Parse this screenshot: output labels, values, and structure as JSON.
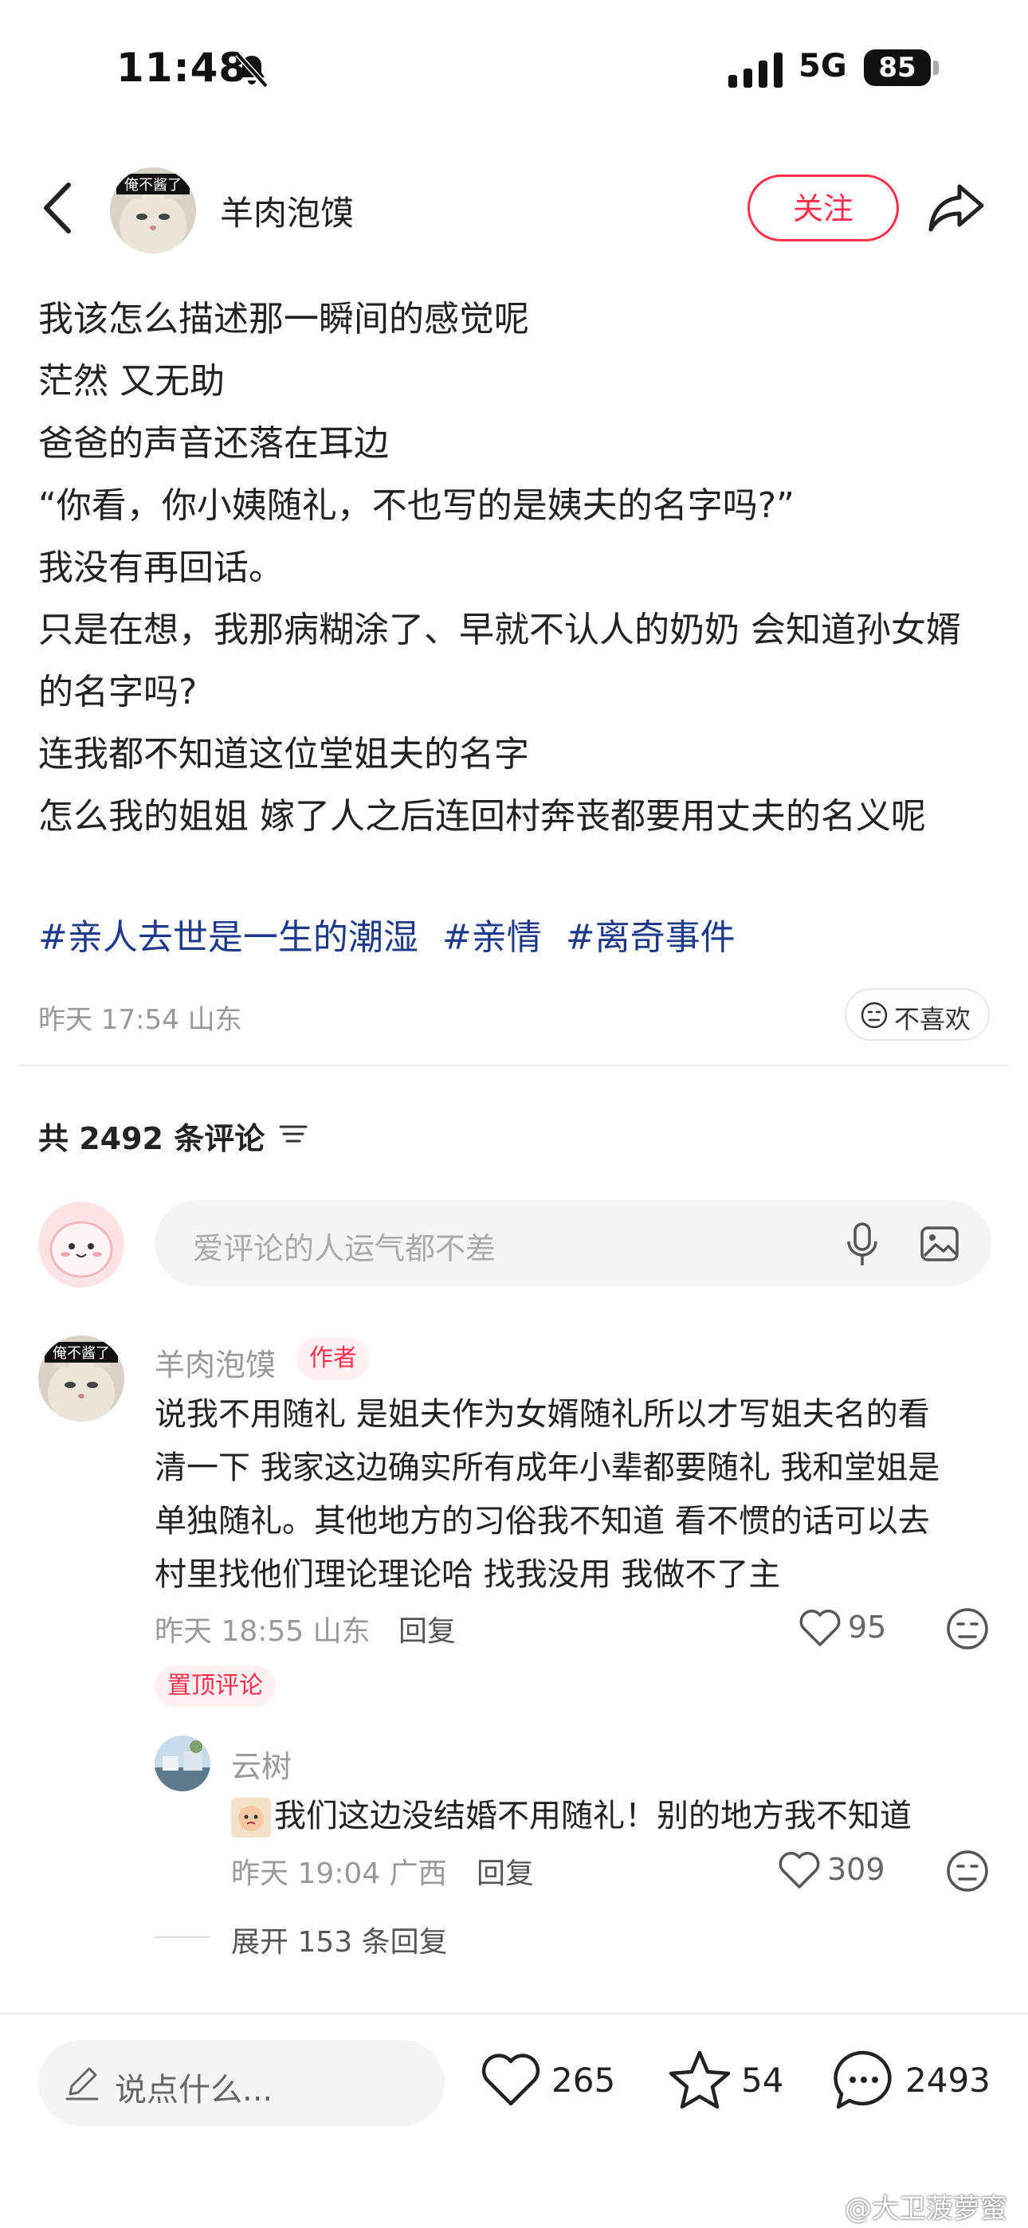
{
  "status_bar": {
    "time": "11:48",
    "network": "5G",
    "battery": "85"
  },
  "header": {
    "author": "羊肉泡馍",
    "avatar_text": "俺不酱了",
    "follow_label": "关注"
  },
  "post": {
    "lines": [
      "我该怎么描述那一瞬间的感觉呢",
      "茫然 又无助",
      "爸爸的声音还落在耳边",
      "“你看，你小姨随礼，不也写的是姨夫的名字吗?”",
      "我没有再回话。",
      "只是在想，我那病糊涂了、早就不认人的奶奶 会知道孙女婿的名字吗?",
      "连我都不知道这位堂姐夫的名字",
      "怎么我的姐姐 嫁了人之后连回村奔丧都要用丈夫的名义呢"
    ],
    "tags": [
      "#亲人去世是一生的潮湿",
      "#亲情",
      "#离奇事件"
    ],
    "meta": "昨天 17:54 山东",
    "dislike_label": "不喜欢"
  },
  "comments_section": {
    "count_label": "共 2492 条评论",
    "input_placeholder": "爱评论的人运气都不差"
  },
  "comment": {
    "author": "羊肉泡馍",
    "avatar_text": "俺不酱了",
    "badge": "作者",
    "lines": [
      "说我不用随礼 是姐夫作为女婿随礼所以才写姐夫名的看",
      "清一下 我家这边确实所有成年小辈都要随礼  我和堂姐是",
      "单独随礼。其他地方的习俗我不知道 看不惯的话可以去",
      "村里找他们理论理论哈 找我没用 我做不了主"
    ],
    "meta": "昨天 18:55 山东",
    "reply_label": "回复",
    "likes": "95",
    "pinned_label": "置顶评论"
  },
  "reply": {
    "author": "云树",
    "text": "我们这边没结婚不用随礼！别的地方我不知道",
    "meta": "昨天 19:04 广西",
    "reply_label": "回复",
    "likes": "309",
    "expand_label": "展开 153 条回复"
  },
  "bottom_bar": {
    "placeholder": "说点什么...",
    "likes": "265",
    "stars": "54",
    "comments": "2493"
  },
  "watermark": "@大卫菠萝蜜",
  "colors": {
    "accent": "#ff2e4d",
    "tag": "#1f3a8a"
  }
}
